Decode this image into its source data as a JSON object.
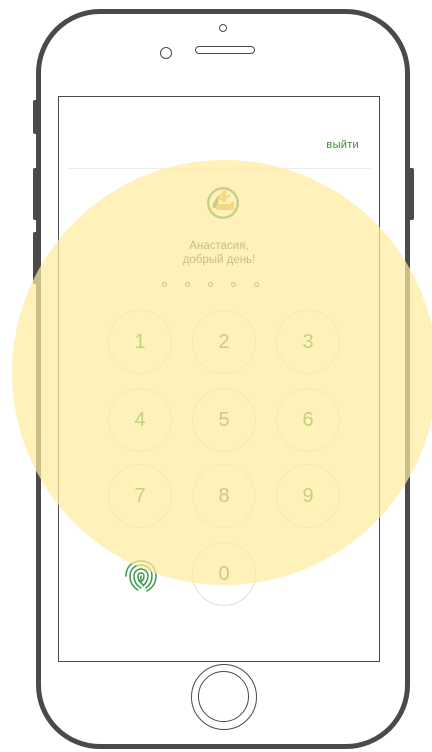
{
  "header": {
    "exit_label": "выйти"
  },
  "greeting": {
    "line1": "Анастасия,",
    "line2": "добрый день!"
  },
  "pin": {
    "length": 5
  },
  "keypad": {
    "k1": "1",
    "k2": "2",
    "k3": "3",
    "k4": "4",
    "k5": "5",
    "k6": "6",
    "k7": "7",
    "k8": "8",
    "k9": "9",
    "k0": "0"
  },
  "colors": {
    "accent": "#2e8b2e",
    "highlight": "#fdeba0"
  },
  "icons": {
    "biometric": "fingerprint-icon",
    "brand": "bank-logo-icon"
  }
}
